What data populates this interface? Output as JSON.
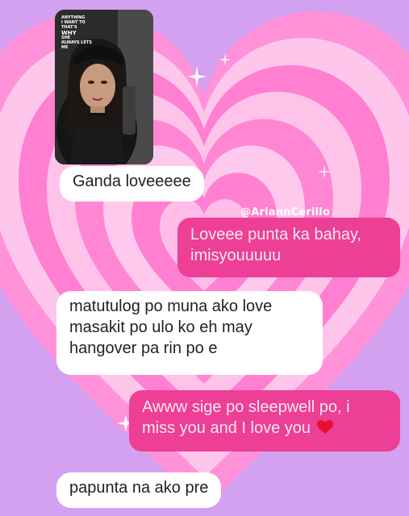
{
  "photo_card": {
    "story_text": [
      "ANYTHING",
      "I WANT TO",
      "THAT'S",
      "WHY",
      "SHE",
      "ALWAYS LETS",
      "ME"
    ]
  },
  "watermark": "@AriannCerillo",
  "messages": [
    {
      "direction": "incoming",
      "text": "Ganda loveeeee"
    },
    {
      "direction": "outgoing",
      "text": "Loveee punta ka bahay, imisyouuuuu"
    },
    {
      "direction": "incoming",
      "text": "matutulog po muna ako love masakit po ulo ko eh may hangover pa rin po e"
    },
    {
      "direction": "outgoing",
      "text": "Awww sige po sleepwell po, i miss you and I love you",
      "emoji": "red-heart-icon"
    },
    {
      "direction": "incoming",
      "text": "papunta na ako pre"
    }
  ],
  "colors": {
    "background": "#d4a0f0",
    "heart_pink": "#ff7fd0",
    "heart_light": "#ffc3ea",
    "outgoing_bubble": "#ec3f95",
    "incoming_bubble": "#ffffff"
  }
}
